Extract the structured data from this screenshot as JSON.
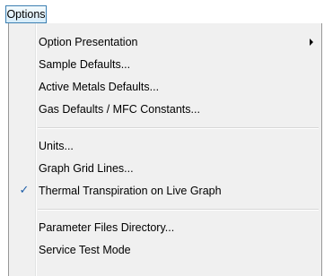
{
  "menubar": {
    "options_label": "Options"
  },
  "menu": {
    "items": [
      {
        "label": "Option Presentation"
      },
      {
        "label": "Sample Defaults..."
      },
      {
        "label": "Active Metals Defaults..."
      },
      {
        "label": "Gas Defaults / MFC Constants..."
      },
      {
        "label": "Units..."
      },
      {
        "label": "Graph Grid Lines..."
      },
      {
        "label": "Thermal Transpiration on Live Graph",
        "checked": true
      },
      {
        "label": "Parameter Files Directory..."
      },
      {
        "label": "Service Test Mode"
      }
    ],
    "check_mark": "✓"
  },
  "colors": {
    "menu_background": "#f0f0f0",
    "menu_border": "#979797",
    "check_color": "#1f5fa8",
    "button_border": "#3c7fb1"
  },
  "icons": {
    "submenu": "submenu-arrow-icon",
    "check": "checkmark-icon"
  }
}
